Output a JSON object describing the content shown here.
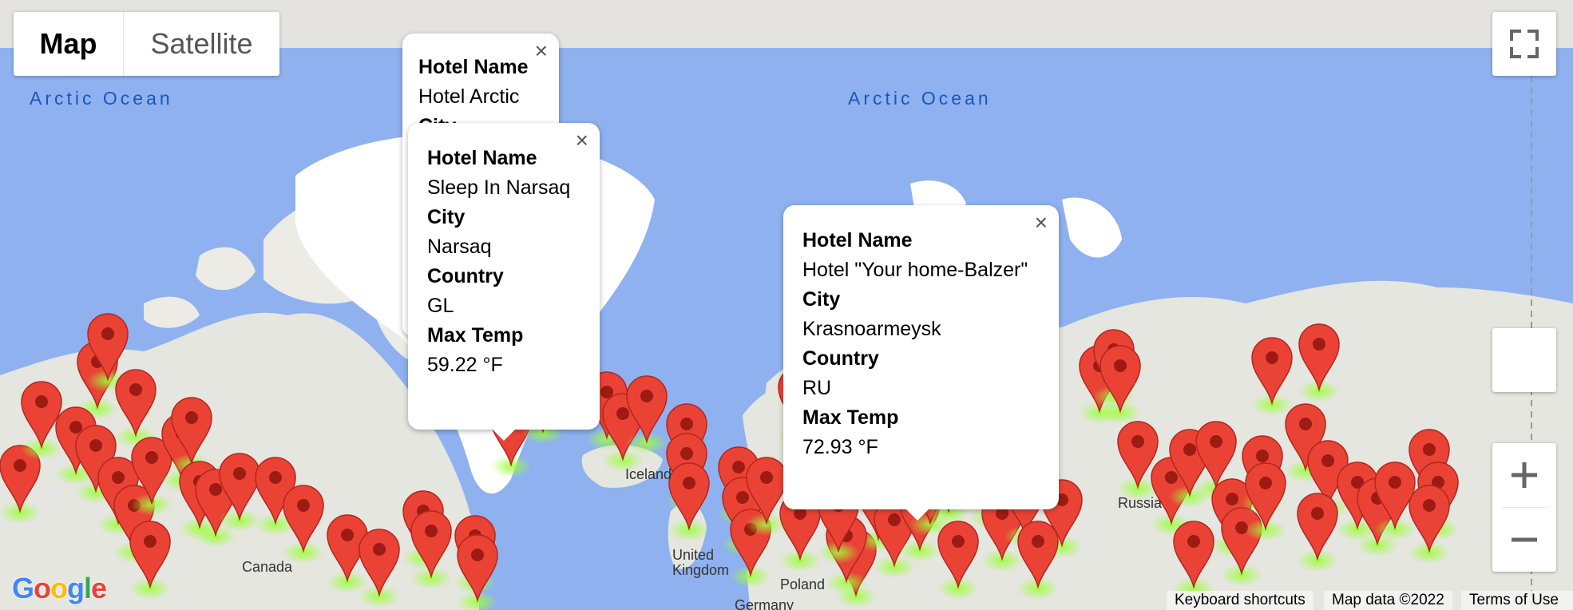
{
  "map_type": {
    "map_label": "Map",
    "satellite_label": "Satellite",
    "selected": "Map"
  },
  "oceans": [
    "Arctic Ocean",
    "Arctic Ocean"
  ],
  "land_labels": [
    "Canada",
    "Iceland",
    "United Kingdom",
    "Poland",
    "Germany",
    "Russia"
  ],
  "info_windows": [
    {
      "fields": [
        {
          "key": "Hotel Name",
          "value": "Hotel Arctic"
        },
        {
          "key": "City",
          "value": ""
        }
      ]
    },
    {
      "fields": [
        {
          "key": "Hotel Name",
          "value": "Sleep In Narsaq"
        },
        {
          "key": "City",
          "value": "Narsaq"
        },
        {
          "key": "Country",
          "value": "GL"
        },
        {
          "key": "Max Temp",
          "value": "59.22 °F"
        }
      ]
    },
    {
      "fields": [
        {
          "key": "Hotel Name",
          "value": "Hotel \"Your home-Balzer\""
        },
        {
          "key": "City",
          "value": "Krasnoarmeysk"
        },
        {
          "key": "Country",
          "value": "RU"
        },
        {
          "key": "Max Temp",
          "value": "72.93 °F"
        }
      ]
    }
  ],
  "close_symbol": "×",
  "controls": {
    "zoom_in": "+",
    "zoom_out": "−",
    "fullscreen_icon": "fullscreen-icon",
    "pegman_icon": "pegman-icon"
  },
  "footer": {
    "keyboard_shortcuts": "Keyboard shortcuts",
    "map_data": "Map data ©2022",
    "terms": "Terms of Use"
  },
  "logo": "Google",
  "colors": {
    "water": "#8fb1ef",
    "land": "#e7e6e1",
    "ice": "#ffffff",
    "marker": "#ea4335",
    "marker_dot": "#9d1b12",
    "heat": "#9dff3a",
    "ocean_label": "#1a56bd"
  }
}
